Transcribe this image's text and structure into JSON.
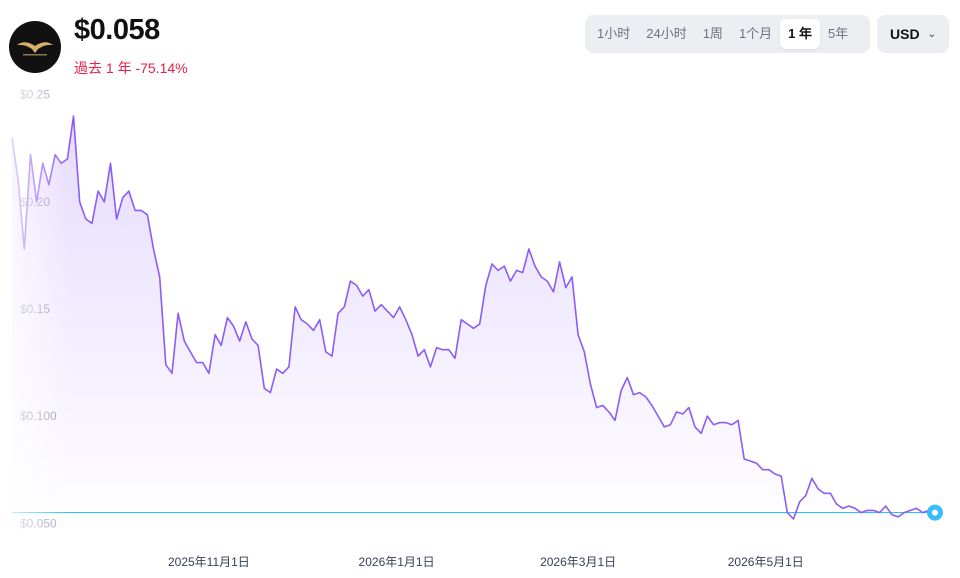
{
  "header": {
    "price": "$0.058",
    "change": "過去 1 年 -75.14%"
  },
  "ranges": [
    {
      "label": "1小时",
      "active": false
    },
    {
      "label": "24小时",
      "active": false
    },
    {
      "label": "1周",
      "active": false
    },
    {
      "label": "1个月",
      "active": false
    },
    {
      "label": "1 年",
      "active": true
    },
    {
      "label": "5年",
      "active": false
    }
  ],
  "currency": {
    "label": "USD"
  },
  "colors": {
    "line": "#8b5cf6",
    "baseline": "#38bdf8",
    "negative": "#e5204a"
  },
  "chart_data": {
    "type": "line",
    "ylim": [
      0.045,
      0.255
    ],
    "yticks": [
      {
        "value": 0.25,
        "label": "$0.25"
      },
      {
        "value": 0.2,
        "label": "$0.20"
      },
      {
        "value": 0.15,
        "label": "$0.15"
      },
      {
        "value": 0.1,
        "label": "$0.100"
      },
      {
        "value": 0.05,
        "label": "$0.050"
      }
    ],
    "xlim": [
      "2025-08-29",
      "2026-06-25"
    ],
    "xticks": [
      {
        "date": "2025-11-01",
        "label": "2025年11月1日"
      },
      {
        "date": "2026-01-01",
        "label": "2026年1月1日"
      },
      {
        "date": "2026-03-01",
        "label": "2026年3月1日"
      },
      {
        "date": "2026-05-01",
        "label": "2026年5月1日"
      }
    ],
    "reference_value": 0.055,
    "series": [
      {
        "points": [
          [
            "2025-08-29",
            0.23
          ],
          [
            "2025-08-31",
            0.21
          ],
          [
            "2025-09-02",
            0.178
          ],
          [
            "2025-09-04",
            0.222
          ],
          [
            "2025-09-06",
            0.2
          ],
          [
            "2025-09-08",
            0.218
          ],
          [
            "2025-09-10",
            0.208
          ],
          [
            "2025-09-12",
            0.222
          ],
          [
            "2025-09-14",
            0.218
          ],
          [
            "2025-09-16",
            0.22
          ],
          [
            "2025-09-18",
            0.24
          ],
          [
            "2025-09-20",
            0.2
          ],
          [
            "2025-09-22",
            0.192
          ],
          [
            "2025-09-24",
            0.19
          ],
          [
            "2025-09-26",
            0.205
          ],
          [
            "2025-09-28",
            0.2
          ],
          [
            "2025-09-30",
            0.218
          ],
          [
            "2025-10-02",
            0.192
          ],
          [
            "2025-10-04",
            0.202
          ],
          [
            "2025-10-06",
            0.205
          ],
          [
            "2025-10-08",
            0.196
          ],
          [
            "2025-10-10",
            0.196
          ],
          [
            "2025-10-12",
            0.194
          ],
          [
            "2025-10-14",
            0.178
          ],
          [
            "2025-10-16",
            0.165
          ],
          [
            "2025-10-18",
            0.124
          ],
          [
            "2025-10-20",
            0.12
          ],
          [
            "2025-10-22",
            0.148
          ],
          [
            "2025-10-24",
            0.135
          ],
          [
            "2025-10-26",
            0.13
          ],
          [
            "2025-10-28",
            0.125
          ],
          [
            "2025-10-30",
            0.125
          ],
          [
            "2025-11-01",
            0.12
          ],
          [
            "2025-11-03",
            0.138
          ],
          [
            "2025-11-05",
            0.133
          ],
          [
            "2025-11-07",
            0.146
          ],
          [
            "2025-11-09",
            0.142
          ],
          [
            "2025-11-11",
            0.135
          ],
          [
            "2025-11-13",
            0.144
          ],
          [
            "2025-11-15",
            0.136
          ],
          [
            "2025-11-17",
            0.133
          ],
          [
            "2025-11-19",
            0.113
          ],
          [
            "2025-11-21",
            0.111
          ],
          [
            "2025-11-23",
            0.122
          ],
          [
            "2025-11-25",
            0.12
          ],
          [
            "2025-11-27",
            0.123
          ],
          [
            "2025-11-29",
            0.151
          ],
          [
            "2025-12-01",
            0.145
          ],
          [
            "2025-12-03",
            0.143
          ],
          [
            "2025-12-05",
            0.14
          ],
          [
            "2025-12-07",
            0.145
          ],
          [
            "2025-12-09",
            0.13
          ],
          [
            "2025-12-11",
            0.128
          ],
          [
            "2025-12-13",
            0.148
          ],
          [
            "2025-12-15",
            0.151
          ],
          [
            "2025-12-17",
            0.163
          ],
          [
            "2025-12-19",
            0.161
          ],
          [
            "2025-12-21",
            0.156
          ],
          [
            "2025-12-23",
            0.159
          ],
          [
            "2025-12-25",
            0.149
          ],
          [
            "2025-12-27",
            0.152
          ],
          [
            "2025-12-29",
            0.149
          ],
          [
            "2025-12-31",
            0.146
          ],
          [
            "2026-01-02",
            0.151
          ],
          [
            "2026-01-04",
            0.145
          ],
          [
            "2026-01-06",
            0.138
          ],
          [
            "2026-01-08",
            0.128
          ],
          [
            "2026-01-10",
            0.131
          ],
          [
            "2026-01-12",
            0.123
          ],
          [
            "2026-01-14",
            0.132
          ],
          [
            "2026-01-16",
            0.131
          ],
          [
            "2026-01-18",
            0.131
          ],
          [
            "2026-01-20",
            0.127
          ],
          [
            "2026-01-22",
            0.145
          ],
          [
            "2026-01-24",
            0.143
          ],
          [
            "2026-01-26",
            0.141
          ],
          [
            "2026-01-28",
            0.143
          ],
          [
            "2026-01-30",
            0.161
          ],
          [
            "2026-02-01",
            0.171
          ],
          [
            "2026-02-03",
            0.168
          ],
          [
            "2026-02-05",
            0.17
          ],
          [
            "2026-02-07",
            0.163
          ],
          [
            "2026-02-09",
            0.168
          ],
          [
            "2026-02-11",
            0.167
          ],
          [
            "2026-02-13",
            0.178
          ],
          [
            "2026-02-15",
            0.17
          ],
          [
            "2026-02-17",
            0.165
          ],
          [
            "2026-02-19",
            0.163
          ],
          [
            "2026-02-21",
            0.158
          ],
          [
            "2026-02-23",
            0.172
          ],
          [
            "2026-02-25",
            0.16
          ],
          [
            "2026-02-27",
            0.165
          ],
          [
            "2026-03-01",
            0.138
          ],
          [
            "2026-03-03",
            0.13
          ],
          [
            "2026-03-05",
            0.115
          ],
          [
            "2026-03-07",
            0.104
          ],
          [
            "2026-03-09",
            0.105
          ],
          [
            "2026-03-11",
            0.102
          ],
          [
            "2026-03-13",
            0.098
          ],
          [
            "2026-03-15",
            0.112
          ],
          [
            "2026-03-17",
            0.118
          ],
          [
            "2026-03-19",
            0.11
          ],
          [
            "2026-03-21",
            0.111
          ],
          [
            "2026-03-23",
            0.109
          ],
          [
            "2026-03-25",
            0.105
          ],
          [
            "2026-03-27",
            0.1
          ],
          [
            "2026-03-29",
            0.095
          ],
          [
            "2026-03-31",
            0.096
          ],
          [
            "2026-04-02",
            0.102
          ],
          [
            "2026-04-04",
            0.101
          ],
          [
            "2026-04-06",
            0.104
          ],
          [
            "2026-04-08",
            0.095
          ],
          [
            "2026-04-10",
            0.092
          ],
          [
            "2026-04-12",
            0.1
          ],
          [
            "2026-04-14",
            0.096
          ],
          [
            "2026-04-16",
            0.097
          ],
          [
            "2026-04-18",
            0.097
          ],
          [
            "2026-04-20",
            0.096
          ],
          [
            "2026-04-22",
            0.098
          ],
          [
            "2026-04-24",
            0.08
          ],
          [
            "2026-04-26",
            0.079
          ],
          [
            "2026-04-28",
            0.078
          ],
          [
            "2026-04-30",
            0.075
          ],
          [
            "2026-05-02",
            0.075
          ],
          [
            "2026-05-04",
            0.073
          ],
          [
            "2026-05-06",
            0.072
          ],
          [
            "2026-05-08",
            0.055
          ],
          [
            "2026-05-10",
            0.052
          ],
          [
            "2026-05-12",
            0.06
          ],
          [
            "2026-05-14",
            0.063
          ],
          [
            "2026-05-16",
            0.071
          ],
          [
            "2026-05-18",
            0.066
          ],
          [
            "2026-05-20",
            0.064
          ],
          [
            "2026-05-22",
            0.064
          ],
          [
            "2026-05-24",
            0.059
          ],
          [
            "2026-05-26",
            0.057
          ],
          [
            "2026-05-28",
            0.058
          ],
          [
            "2026-05-30",
            0.057
          ],
          [
            "2026-06-01",
            0.055
          ],
          [
            "2026-06-03",
            0.056
          ],
          [
            "2026-06-05",
            0.056
          ],
          [
            "2026-06-07",
            0.055
          ],
          [
            "2026-06-09",
            0.058
          ],
          [
            "2026-06-11",
            0.054
          ],
          [
            "2026-06-13",
            0.053
          ],
          [
            "2026-06-15",
            0.055
          ],
          [
            "2026-06-17",
            0.056
          ],
          [
            "2026-06-19",
            0.057
          ],
          [
            "2026-06-21",
            0.055
          ],
          [
            "2026-06-23",
            0.056
          ],
          [
            "2026-06-25",
            0.055
          ]
        ]
      }
    ]
  }
}
